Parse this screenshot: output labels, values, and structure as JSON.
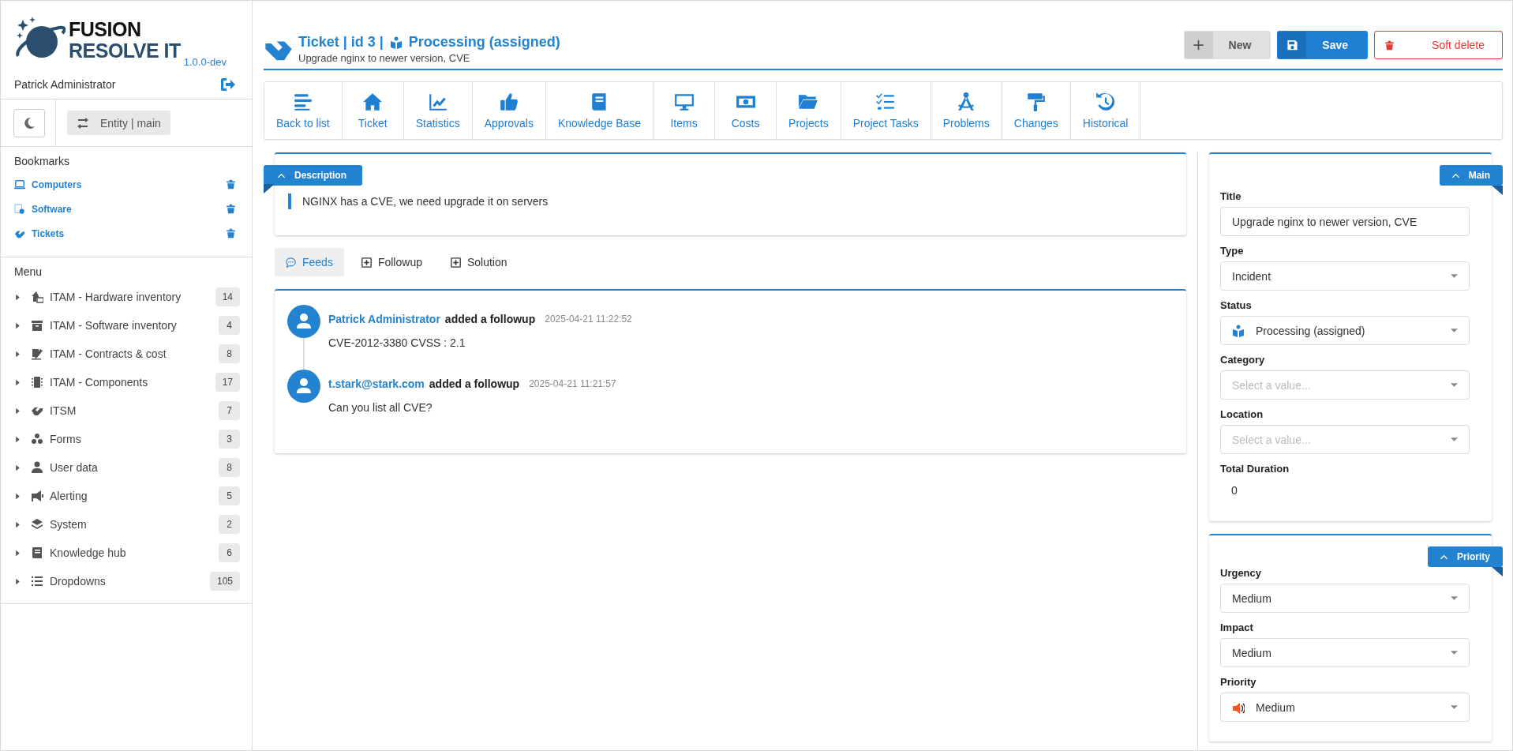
{
  "sidebar": {
    "logo": {
      "line1": "FUSION",
      "line2": "RESOLVE IT",
      "version": "1.0.0-dev"
    },
    "user": "Patrick Administrator",
    "entity_button": "Entity | main",
    "bookmarks": {
      "title": "Bookmarks",
      "items": [
        {
          "label": "Computers"
        },
        {
          "label": "Software"
        },
        {
          "label": "Tickets"
        }
      ]
    },
    "menu": {
      "title": "Menu",
      "items": [
        {
          "label": "ITAM - Hardware inventory",
          "count": "14",
          "expanded": false
        },
        {
          "label": "ITAM - Software inventory",
          "count": "4",
          "expanded": false
        },
        {
          "label": "ITAM - Contracts & cost",
          "count": "8",
          "expanded": false
        },
        {
          "label": "ITAM - Components",
          "count": "17",
          "expanded": false
        },
        {
          "label": "ITSM",
          "count": "7",
          "expanded": false
        },
        {
          "label": "Forms",
          "count": "3",
          "expanded": false
        },
        {
          "label": "User data",
          "count": "8",
          "expanded": false
        },
        {
          "label": "Alerting",
          "count": "5",
          "expanded": false
        },
        {
          "label": "System",
          "count": "2",
          "expanded": false
        },
        {
          "label": "Knowledge hub",
          "count": "6",
          "expanded": false
        },
        {
          "label": "Dropdowns",
          "count": "105",
          "expanded": false
        }
      ]
    }
  },
  "header": {
    "title": "Ticket | id 3 |",
    "status": "Processing (assigned)",
    "subtitle": "Upgrade nginx to newer version, CVE",
    "buttons": [
      {
        "label": "New",
        "kind": "secondary"
      },
      {
        "label": "Save",
        "kind": "primary"
      },
      {
        "label": "Soft delete",
        "kind": "danger"
      }
    ]
  },
  "toolbar": [
    {
      "label": "Back to list"
    },
    {
      "label": "Ticket"
    },
    {
      "label": "Statistics"
    },
    {
      "label": "Approvals"
    },
    {
      "label": "Knowledge Base"
    },
    {
      "label": "Items"
    },
    {
      "label": "Costs"
    },
    {
      "label": "Projects"
    },
    {
      "label": "Project Tasks"
    },
    {
      "label": "Problems"
    },
    {
      "label": "Changes"
    },
    {
      "label": "Historical"
    }
  ],
  "description": {
    "tag": "Description",
    "text": "NGINX has a CVE, we need upgrade it on servers"
  },
  "feed_tabs": [
    {
      "label": "Feeds",
      "selected": true
    },
    {
      "label": "Followup",
      "selected": false
    },
    {
      "label": "Solution",
      "selected": false
    }
  ],
  "feed": [
    {
      "author": "Patrick Administrator",
      "action": "added a followup",
      "time": "2025-04-21 11:22:52",
      "text": "CVE-2012-3380 CVSS : 2.1"
    },
    {
      "author": "t.stark@stark.com",
      "action": "added a followup",
      "time": "2025-04-21 11:21:57",
      "text": "Can you list all CVE?"
    }
  ],
  "panels": [
    {
      "tag": "Main",
      "fields": [
        {
          "label": "Title",
          "kind": "input",
          "value": "Upgrade nginx to newer version, CVE"
        },
        {
          "label": "Type",
          "kind": "select",
          "value": "Incident"
        },
        {
          "label": "Status",
          "kind": "select",
          "value": "Processing (assigned)"
        },
        {
          "label": "Category",
          "kind": "select",
          "placeholder": "Select a value..."
        },
        {
          "label": "Location",
          "kind": "select",
          "placeholder": "Select a value..."
        },
        {
          "label": "Total Duration",
          "kind": "static",
          "value": "0"
        }
      ]
    },
    {
      "tag": "Priority",
      "fields": [
        {
          "label": "Urgency",
          "kind": "select",
          "value": "Medium"
        },
        {
          "label": "Impact",
          "kind": "select",
          "value": "Medium"
        },
        {
          "label": "Priority",
          "kind": "select",
          "value": "Medium"
        }
      ]
    }
  ]
}
